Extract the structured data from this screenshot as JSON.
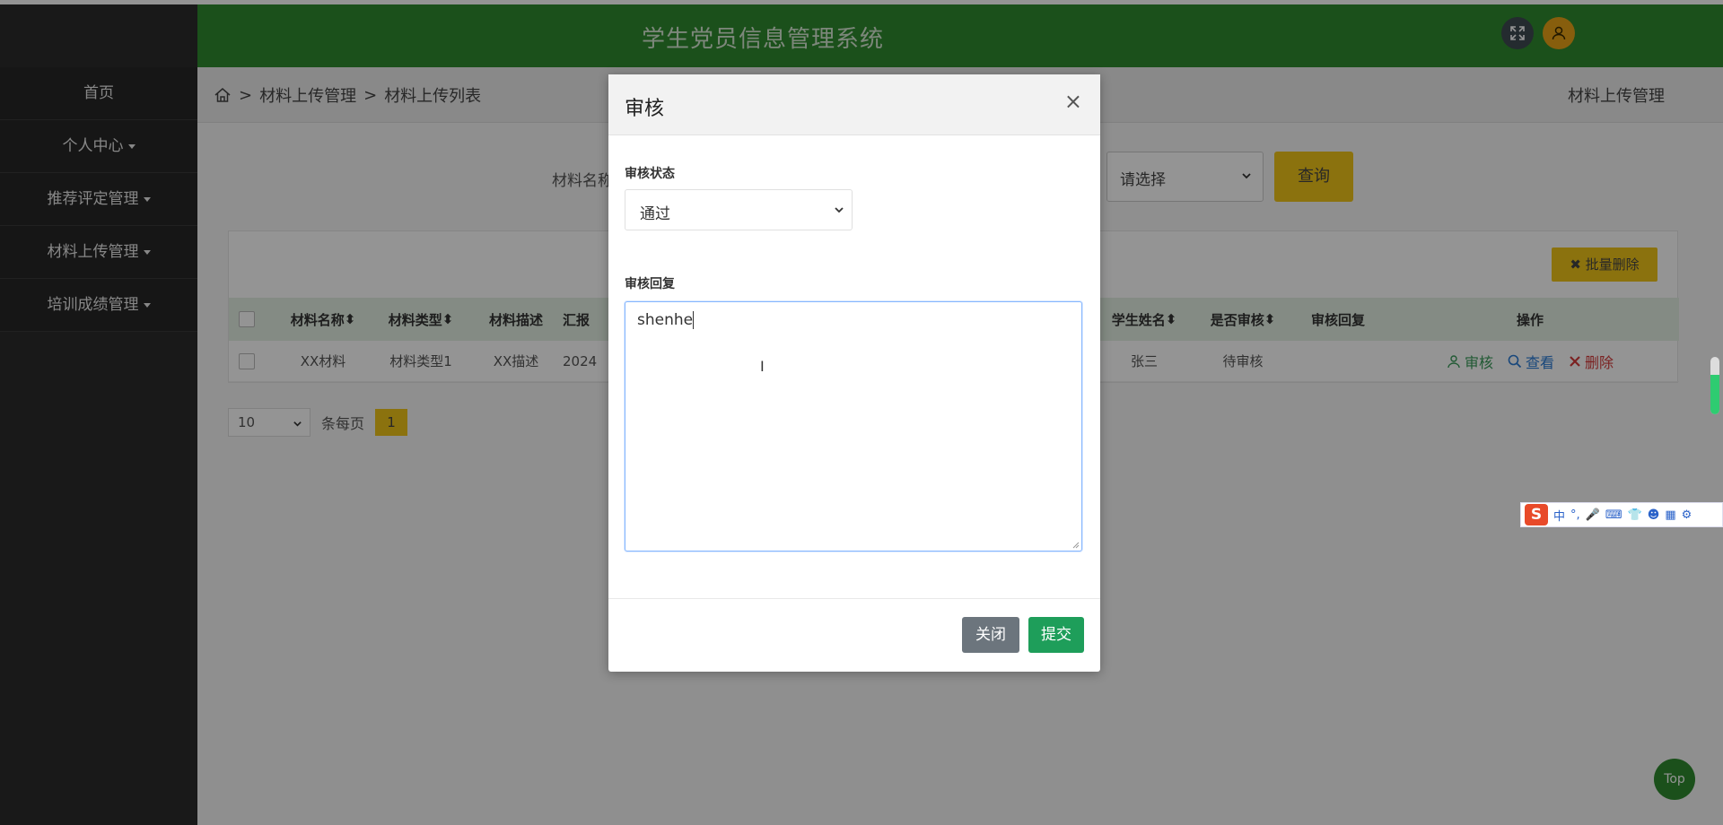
{
  "header": {
    "title": "学生党员信息管理系统"
  },
  "sidebar": {
    "items": [
      {
        "label": "首页",
        "has_dropdown": false
      },
      {
        "label": "个人中心",
        "has_dropdown": true
      },
      {
        "label": "推荐评定管理",
        "has_dropdown": true
      },
      {
        "label": "材料上传管理",
        "has_dropdown": true
      },
      {
        "label": "培训成绩管理",
        "has_dropdown": true
      }
    ]
  },
  "breadcrumb": {
    "separator": ">",
    "level1": "材料上传管理",
    "level2": "材料上传列表",
    "right_title": "材料上传管理"
  },
  "search": {
    "label": "材料名称",
    "select_value": "请选择",
    "query_label": "查询"
  },
  "toolbar": {
    "batch_delete_label": "批量删除"
  },
  "table": {
    "headers": [
      "材料名称",
      "材料类型",
      "材料描述",
      "汇报",
      "学生姓名",
      "是否审核",
      "审核回复",
      "操作"
    ],
    "rows": [
      {
        "name": "XX材料",
        "type": "材料类型1",
        "desc": "XX描述",
        "date": "2024",
        "student": "张三",
        "audit_status": "待审核",
        "reply": ""
      }
    ],
    "ops": {
      "audit": "审核",
      "view": "查看",
      "delete": "删除"
    }
  },
  "pagination": {
    "page_size": "10",
    "per_page_label": "条每页",
    "current_page": "1"
  },
  "top_button": "Top",
  "ime": {
    "mode": "中",
    "punct": "°,"
  },
  "modal": {
    "title": "审核",
    "close_symbol": "×",
    "status_label": "审核状态",
    "status_value": "通过",
    "reply_label": "审核回复",
    "reply_value": "shenhe",
    "close_button": "关闭",
    "submit_button": "提交"
  },
  "colors": {
    "header_green": "#2f8a2f",
    "accent_yellow": "#f0c419",
    "sidebar_dark": "#2b2b2b",
    "submit_green": "#1e9e5a"
  }
}
